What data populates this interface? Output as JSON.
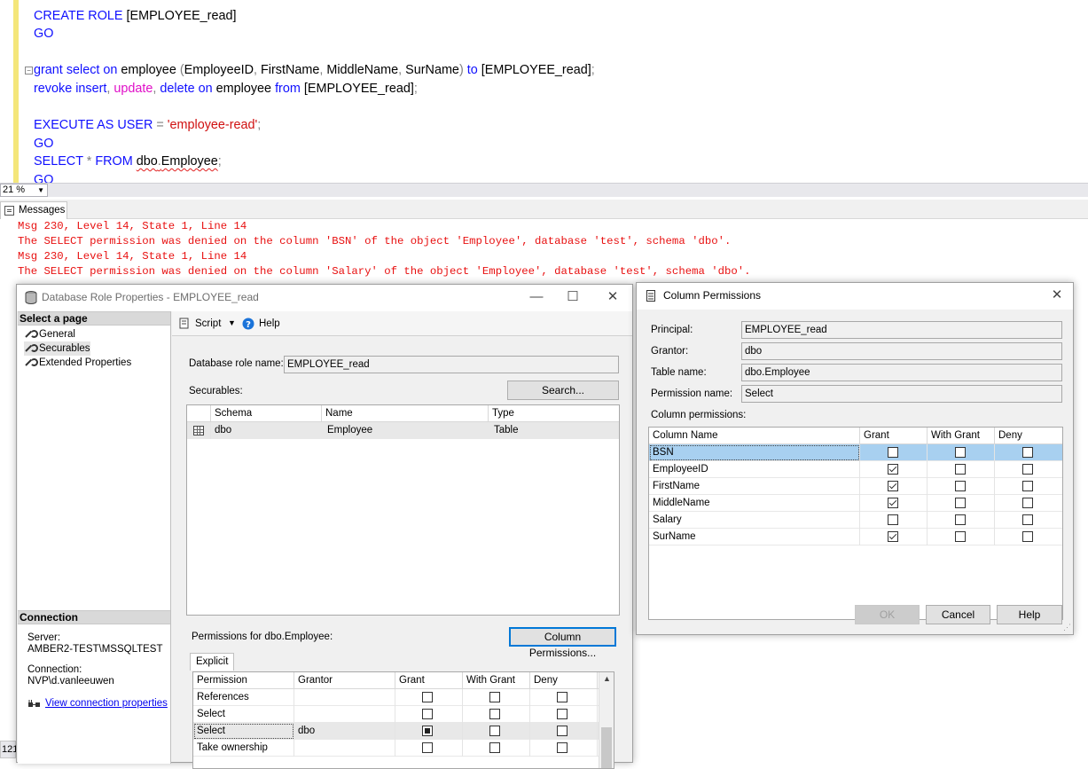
{
  "editor": {
    "lines": {
      "l1": {
        "a": "CREATE ROLE",
        "b": " [EMPLOYEE_read]"
      },
      "l2": {
        "a": "GO"
      },
      "l3": {
        "k1": "grant",
        "s1": " ",
        "k2": "select",
        "s2": " ",
        "k3": "on",
        "t1": " employee ",
        "g1": "(",
        "t2": "EmployeeID",
        "g2": ",",
        "t3": " FirstName",
        "g3": ",",
        "t4": " MiddleName",
        "g4": ",",
        "t5": " SurName",
        "g5": ")",
        "s3": " ",
        "k4": "to",
        "t6": " [EMPLOYEE_read]",
        "g6": ";"
      },
      "l4": {
        "k1": "revoke",
        "s1": " ",
        "k2": "insert",
        "g1": ",",
        "s2": " ",
        "f1": "update",
        "g2": ",",
        "s3": " ",
        "k3": "delete",
        "s4": " ",
        "k4": "on",
        "t1": " employee ",
        "k5": "from",
        "t2": " [EMPLOYEE_read]",
        "g3": ";"
      },
      "l5": {
        "k1": "EXECUTE AS USER",
        "s1": " ",
        "g1": "=",
        "s2": " ",
        "st": "'employee-read'",
        "g2": ";"
      },
      "l6": {
        "a": "GO"
      },
      "l7": {
        "k1": "SELECT",
        "s1": " ",
        "g1": "*",
        "s2": " ",
        "k2": "FROM",
        "s3": " ",
        "t1": "dbo",
        "g2": ".",
        "t2": "Employee",
        "g3": ";"
      },
      "l8": {
        "a": "GO"
      }
    },
    "zoom": "21 %"
  },
  "messages_tab": "Messages",
  "messages": [
    "Msg 230, Level 14, State 1, Line 14",
    "The SELECT permission was denied on the column 'BSN' of the object 'Employee', database 'test', schema 'dbo'.",
    "Msg 230, Level 14, State 1, Line 14",
    "The SELECT permission was denied on the column 'Salary' of the object 'Employee', database 'test', schema 'dbo'."
  ],
  "role_dialog": {
    "title": "Database Role Properties - EMPLOYEE_read",
    "select_page": "Select a page",
    "pages": [
      "General",
      "Securables",
      "Extended Properties"
    ],
    "toolbar": {
      "script": "Script",
      "help": "Help"
    },
    "role_name_label": "Database role name:",
    "role_name": "EMPLOYEE_read",
    "securables_label": "Securables:",
    "search_button": "Search...",
    "securables_columns": [
      "Schema",
      "Name",
      "Type"
    ],
    "securables_rows": [
      {
        "schema": "dbo",
        "name": "Employee",
        "type": "Table"
      }
    ],
    "permissions_label": "Permissions for dbo.Employee:",
    "column_permissions_button": "Column Permissions...",
    "tab_explicit": "Explicit",
    "perm_columns": [
      "Permission",
      "Grantor",
      "Grant",
      "With Grant",
      "Deny"
    ],
    "perm_rows": [
      {
        "permission": "References",
        "grantor": "",
        "grant": "unchecked",
        "with_grant": "unchecked",
        "deny": "unchecked"
      },
      {
        "permission": "Select",
        "grantor": "",
        "grant": "unchecked",
        "with_grant": "unchecked",
        "deny": "unchecked"
      },
      {
        "permission": "Select",
        "grantor": "dbo",
        "grant": "indeterminate",
        "with_grant": "unchecked",
        "deny": "unchecked"
      },
      {
        "permission": "Take ownership",
        "grantor": "",
        "grant": "unchecked",
        "with_grant": "unchecked",
        "deny": "unchecked"
      }
    ],
    "connection_header": "Connection",
    "server_label": "Server:",
    "server_value": "AMBER2-TEST\\MSSQLTEST",
    "connection_label": "Connection:",
    "connection_value": "NVP\\d.vanleeuwen",
    "view_connection_link": "View connection properties"
  },
  "col_dialog": {
    "title": "Column Permissions",
    "principal_label": "Principal:",
    "principal": "EMPLOYEE_read",
    "grantor_label": "Grantor:",
    "grantor": "dbo",
    "table_label": "Table name:",
    "table": "dbo.Employee",
    "permission_label": "Permission name:",
    "permission": "Select",
    "column_permissions_label": "Column permissions:",
    "columns": [
      "Column Name",
      "Grant",
      "With Grant",
      "Deny"
    ],
    "rows": [
      {
        "name": "BSN",
        "grant": false,
        "with_grant": false,
        "deny": false
      },
      {
        "name": "EmployeeID",
        "grant": true,
        "with_grant": false,
        "deny": false
      },
      {
        "name": "FirstName",
        "grant": true,
        "with_grant": false,
        "deny": false
      },
      {
        "name": "MiddleName",
        "grant": true,
        "with_grant": false,
        "deny": false
      },
      {
        "name": "Salary",
        "grant": false,
        "with_grant": false,
        "deny": false
      },
      {
        "name": "SurName",
        "grant": true,
        "with_grant": false,
        "deny": false
      }
    ],
    "ok": "OK",
    "cancel": "Cancel",
    "help": "Help"
  },
  "left_stub": "121",
  "colors": {
    "keyword": "#1010ff",
    "function": "#e010c8",
    "string": "#d01010",
    "error": "#e81010",
    "selection": "#a8d0f0",
    "link": "#0000ee"
  }
}
